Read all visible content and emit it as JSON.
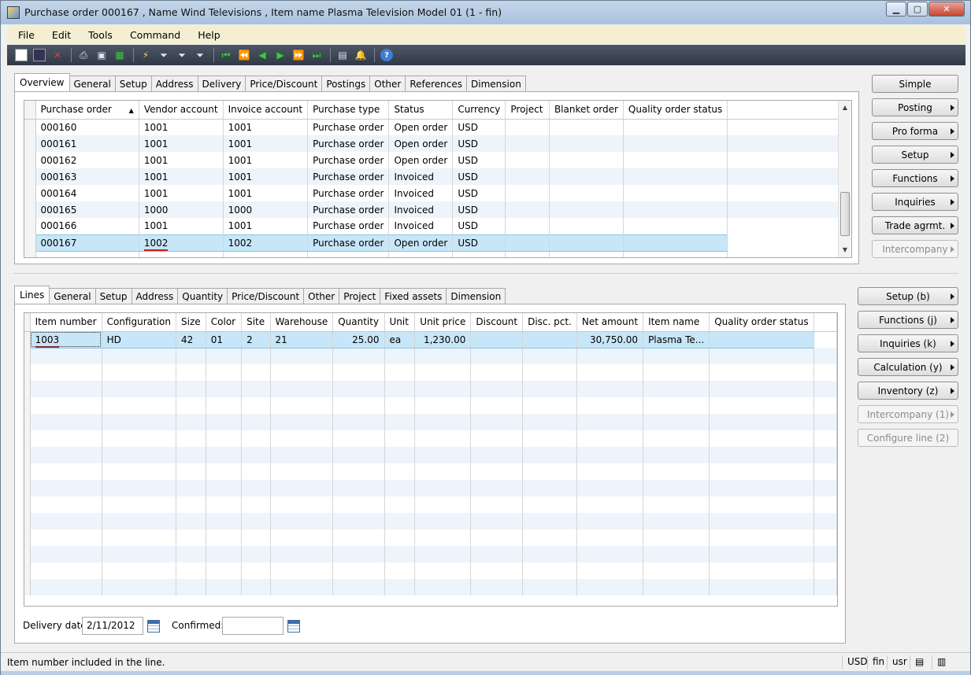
{
  "window": {
    "title": "Purchase order 000167 , Name Wind Televisions , Item name Plasma Television Model 01 (1 - fin)"
  },
  "menu": [
    "File",
    "Edit",
    "Tools",
    "Command",
    "Help"
  ],
  "header_tabs": [
    "Overview",
    "General",
    "Setup",
    "Address",
    "Delivery",
    "Price/Discount",
    "Postings",
    "Other",
    "References",
    "Dimension"
  ],
  "header_grid": {
    "columns": [
      "Purchase order",
      "Vendor account",
      "Invoice account",
      "Purchase type",
      "Status",
      "Currency",
      "Project",
      "Blanket order",
      "Quality order status"
    ],
    "rows": [
      [
        "000160",
        "1001",
        "1001",
        "Purchase order",
        "Open order",
        "USD",
        "",
        "",
        ""
      ],
      [
        "000161",
        "1001",
        "1001",
        "Purchase order",
        "Open order",
        "USD",
        "",
        "",
        ""
      ],
      [
        "000162",
        "1001",
        "1001",
        "Purchase order",
        "Open order",
        "USD",
        "",
        "",
        ""
      ],
      [
        "000163",
        "1001",
        "1001",
        "Purchase order",
        "Invoiced",
        "USD",
        "",
        "",
        ""
      ],
      [
        "000164",
        "1001",
        "1001",
        "Purchase order",
        "Invoiced",
        "USD",
        "",
        "",
        ""
      ],
      [
        "000165",
        "1000",
        "1000",
        "Purchase order",
        "Invoiced",
        "USD",
        "",
        "",
        ""
      ],
      [
        "000166",
        "1001",
        "1001",
        "Purchase order",
        "Invoiced",
        "USD",
        "",
        "",
        ""
      ],
      [
        "000167",
        "1002",
        "1002",
        "Purchase order",
        "Open order",
        "USD",
        "",
        "",
        ""
      ]
    ]
  },
  "header_buttons": [
    "Simple",
    "Posting",
    "Pro forma",
    "Setup",
    "Functions",
    "Inquiries",
    "Trade agrmt.",
    "Intercompany"
  ],
  "line_tabs": [
    "Lines",
    "General",
    "Setup",
    "Address",
    "Quantity",
    "Price/Discount",
    "Other",
    "Project",
    "Fixed assets",
    "Dimension"
  ],
  "lines_grid": {
    "columns": [
      "Item number",
      "Configuration",
      "Size",
      "Color",
      "Site",
      "Warehouse",
      "Quantity",
      "Unit",
      "Unit price",
      "Discount",
      "Disc. pct.",
      "Net amount",
      "Item name",
      "Quality order status"
    ],
    "rows": [
      [
        "1003",
        "HD",
        "42",
        "01",
        "2",
        "21",
        "25.00",
        "ea",
        "1,230.00",
        "",
        "",
        "30,750.00",
        "Plasma Te...",
        ""
      ]
    ]
  },
  "line_buttons": [
    "Setup (b)",
    "Functions (j)",
    "Inquiries (k)",
    "Calculation (y)",
    "Inventory (z)",
    "Intercompany (1)",
    "Configure line (2)"
  ],
  "delivery": {
    "delivery_date_label": "Delivery date:",
    "delivery_date_value": "2/11/2012",
    "confirmed_label": "Confirmed:",
    "confirmed_value": ""
  },
  "status_bar": {
    "message": "Item number included in the line.",
    "currency": "USD",
    "company": "fin",
    "user": "usr"
  }
}
